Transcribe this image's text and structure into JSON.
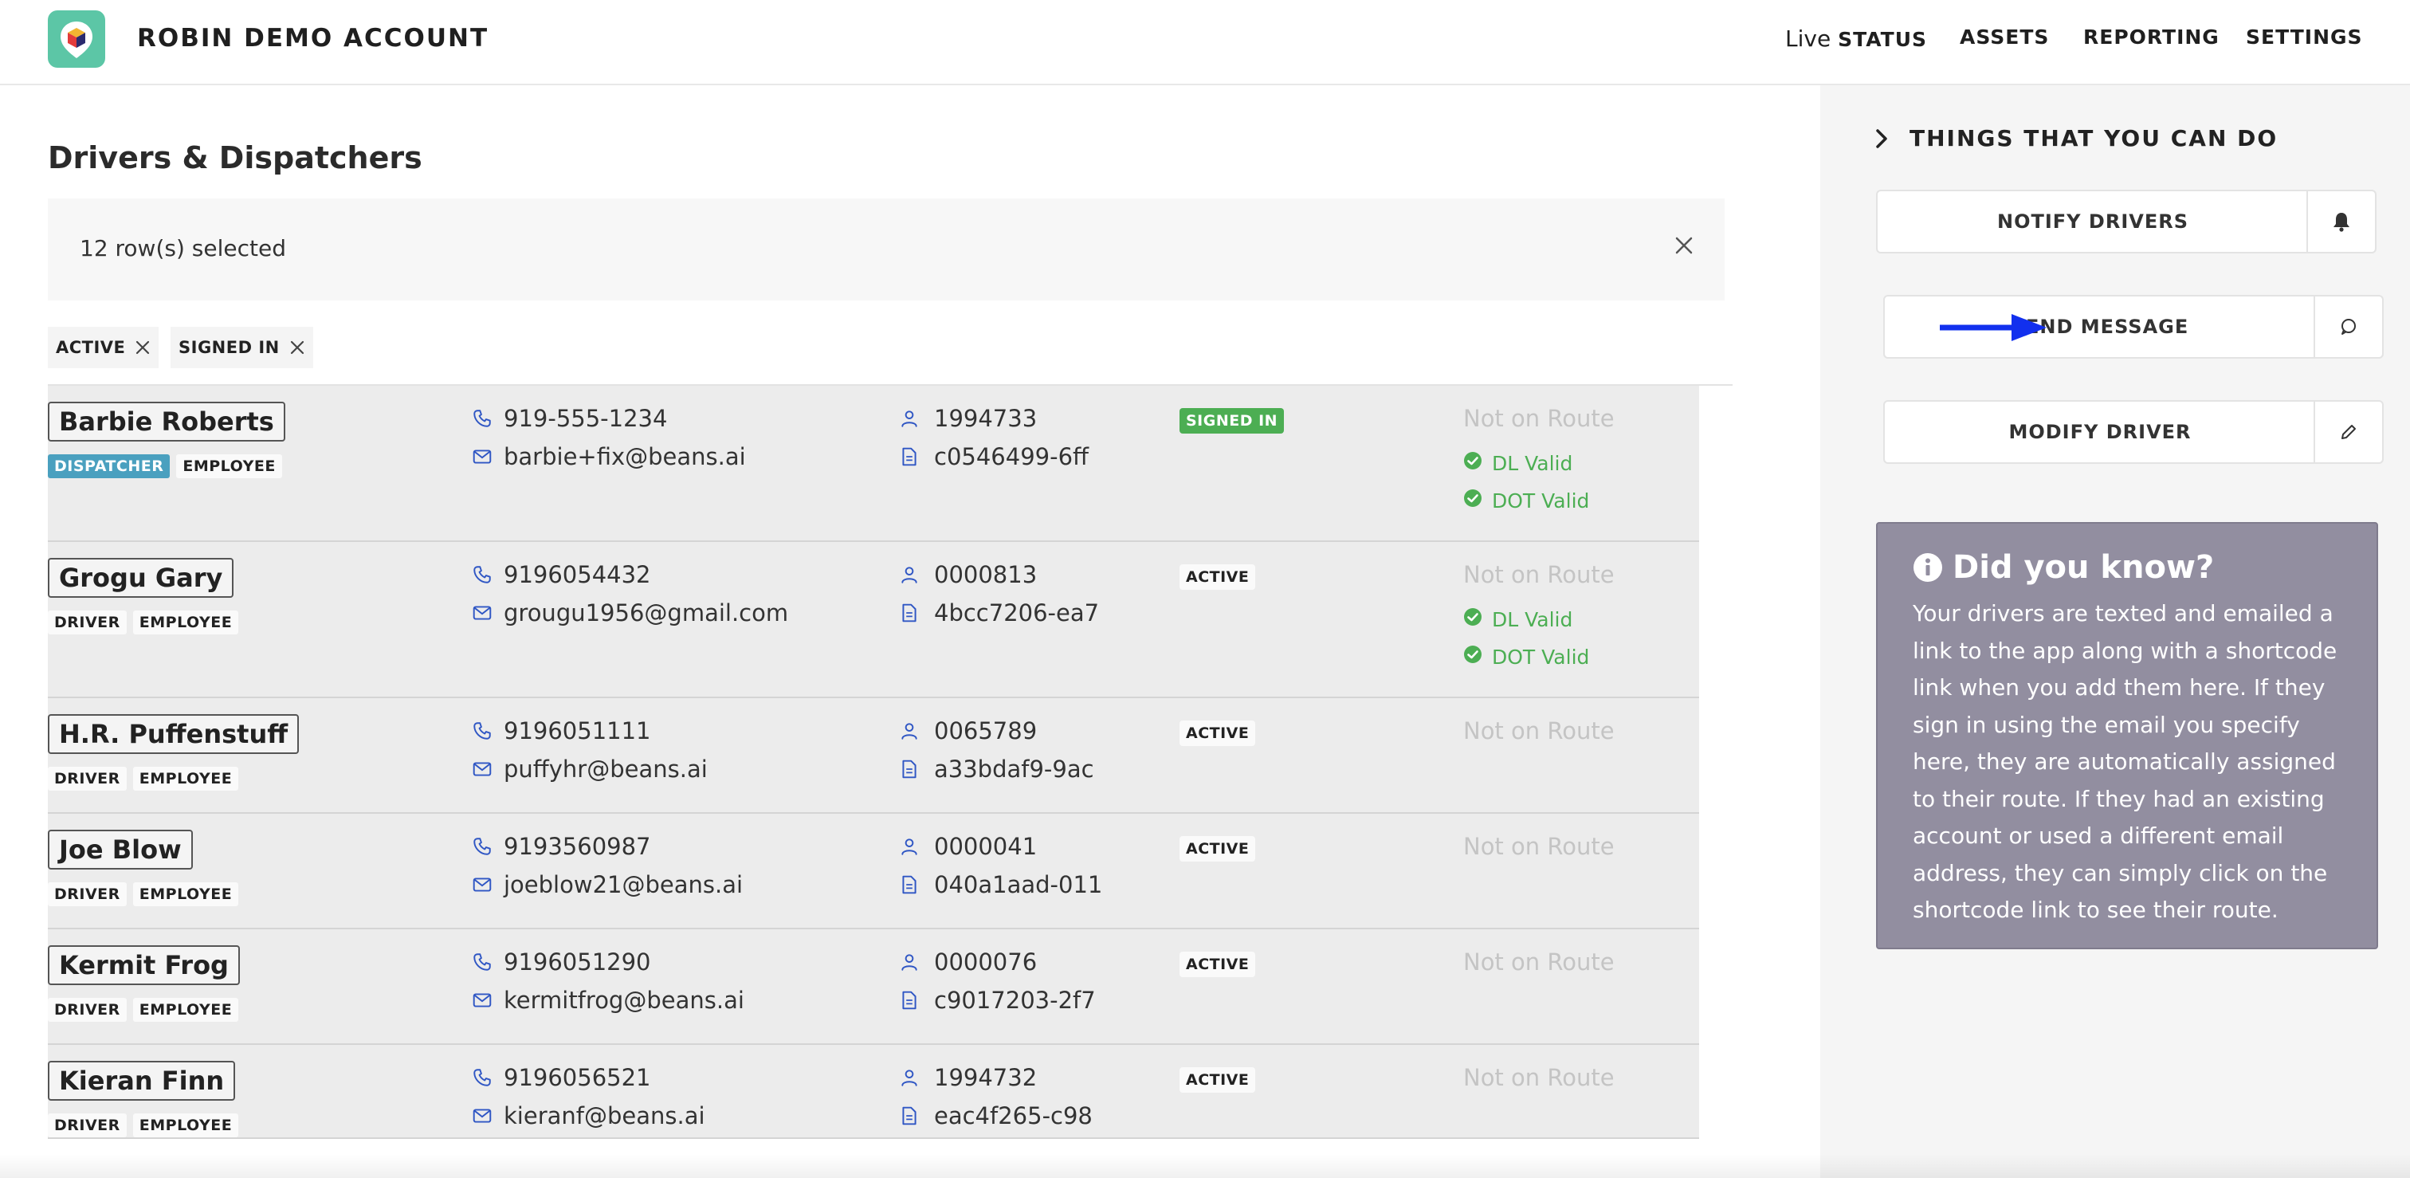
{
  "header": {
    "brand": "ROBIN DEMO ACCOUNT",
    "nav": {
      "live": "Live",
      "status": "STATUS",
      "assets": "ASSETS",
      "reporting": "REPORTING",
      "settings": "SETTINGS"
    }
  },
  "main": {
    "title": "Drivers & Dispatchers",
    "selection_text": "12 row(s) selected",
    "filters": [
      "ACTIVE",
      "SIGNED IN"
    ]
  },
  "drivers": [
    {
      "name": "Barbie Roberts",
      "tags": [
        "DISPATCHER",
        "EMPLOYEE"
      ],
      "phone": "919-555-1234",
      "email": "barbie+fix@beans.ai",
      "id": "1994733",
      "doc": "c0546499-6ff",
      "status": "SIGNED IN",
      "route": "Not on Route",
      "validity": [
        "DL Valid",
        "DOT Valid"
      ]
    },
    {
      "name": "Grogu Gary",
      "tags": [
        "DRIVER",
        "EMPLOYEE"
      ],
      "phone": "9196054432",
      "email": "grougu1956@gmail.com",
      "id": "0000813",
      "doc": "4bcc7206-ea7",
      "status": "ACTIVE",
      "route": "Not on Route",
      "validity": [
        "DL Valid",
        "DOT Valid"
      ]
    },
    {
      "name": "H.R. Puffenstuff",
      "tags": [
        "DRIVER",
        "EMPLOYEE"
      ],
      "phone": "9196051111",
      "email": "puffyhr@beans.ai",
      "id": "0065789",
      "doc": "a33bdaf9-9ac",
      "status": "ACTIVE",
      "route": "Not on Route",
      "validity": []
    },
    {
      "name": "Joe Blow",
      "tags": [
        "DRIVER",
        "EMPLOYEE"
      ],
      "phone": "9193560987",
      "email": "joeblow21@beans.ai",
      "id": "0000041",
      "doc": "040a1aad-011",
      "status": "ACTIVE",
      "route": "Not on Route",
      "validity": []
    },
    {
      "name": "Kermit Frog",
      "tags": [
        "DRIVER",
        "EMPLOYEE"
      ],
      "phone": "9196051290",
      "email": "kermitfrog@beans.ai",
      "id": "0000076",
      "doc": "c9017203-2f7",
      "status": "ACTIVE",
      "route": "Not on Route",
      "validity": []
    },
    {
      "name": "Kieran Finn",
      "tags": [
        "DRIVER",
        "EMPLOYEE"
      ],
      "phone": "9196056521",
      "email": "kieranf@beans.ai",
      "id": "1994732",
      "doc": "eac4f265-c98",
      "status": "ACTIVE",
      "route": "Not on Route",
      "validity": []
    }
  ],
  "panel": {
    "heading": "THINGS THAT YOU CAN DO",
    "actions": [
      {
        "label": "NOTIFY DRIVERS",
        "icon": "bell-icon"
      },
      {
        "label": "SEND MESSAGE",
        "icon": "chat-bubble-icon"
      },
      {
        "label": "MODIFY DRIVER",
        "icon": "pencil-icon"
      }
    ],
    "did_you_know": {
      "title": "Did you know?",
      "body": "Your drivers are texted and emailed a link to the app along with a shortcode link when you add them here. If they sign in using the email you specify here, they are automatically assigned to their route. If they had an existing account or used a different email address, they can simply click on the shortcode link to see their route."
    }
  },
  "colors": {
    "brand_green": "#5cc6a6",
    "dispatcher_tag": "#4aa0bf",
    "signed_in": "#4cae53",
    "valid_green": "#4cae53",
    "info_card": "#928ea0",
    "icon_blue": "#2f56c4",
    "arrow_blue": "#1230ee"
  }
}
